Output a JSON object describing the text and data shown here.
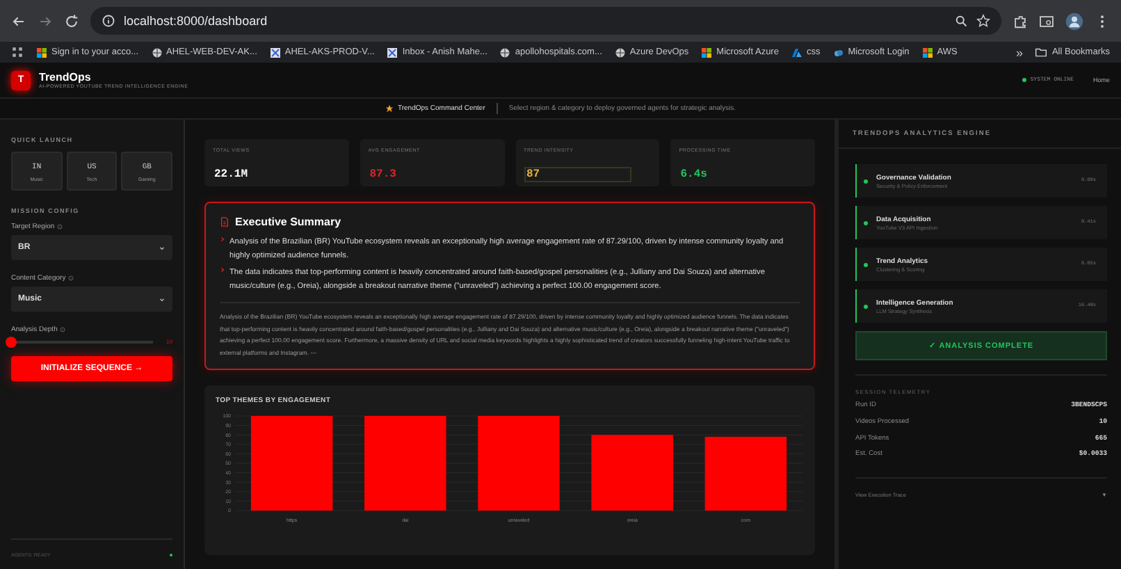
{
  "browser": {
    "url": "localhost:8000/dashboard",
    "bookmarks": [
      "Sign in to your acco...",
      "AHEL-WEB-DEV-AK...",
      "AHEL-AKS-PROD-V...",
      "Inbox - Anish Mahe...",
      "apollohospitals.com...",
      "Azure DevOps",
      "Microsoft Azure",
      "css",
      "Microsoft Login",
      "AWS"
    ],
    "more": "»",
    "all_bookmarks": "All Bookmarks"
  },
  "header": {
    "logo": "T",
    "title": "TrendOps",
    "subtitle": "AI-POWERED YOUTUBE TREND INTELLIGENCE ENGINE",
    "status": "SYSTEM ONLINE",
    "online": true,
    "nav": "Home"
  },
  "command_bar": {
    "title": "TrendOps Command Center",
    "hint": "Select region & category to deploy governed agents for strategic analysis."
  },
  "sidebar": {
    "quick_launch_title": "QUICK LAUNCH",
    "quick_launch": [
      {
        "code": "IN",
        "label": "Music"
      },
      {
        "code": "US",
        "label": "Tech"
      },
      {
        "code": "GB",
        "label": "Gaming"
      }
    ],
    "mission_title": "MISSION CONFIG",
    "fields": [
      {
        "kind": "select",
        "label": "Target Region",
        "value": "BR"
      },
      {
        "kind": "select",
        "label": "Content Category",
        "value": "Music"
      },
      {
        "kind": "slider",
        "label": "Analysis Depth",
        "level": 0,
        "reading": "10"
      }
    ],
    "button": "INITIALIZE SEQUENCE",
    "button_icon": "→",
    "footer": "AGENTS: READY"
  },
  "stats": [
    {
      "label": "TOTAL VIEWS",
      "value": "22.1M",
      "color": "#ffffff",
      "highlighted": false
    },
    {
      "label": "AVG ENGAGEMENT",
      "value": "87.3",
      "color": "#e02424",
      "highlighted": false
    },
    {
      "label": "TREND INTENSITY",
      "value": "87",
      "color": "#e3b341",
      "highlighted": true
    },
    {
      "label": "PROCESSING TIME",
      "value": "6.4s",
      "color": "#22c55e",
      "highlighted": false
    }
  ],
  "summary": {
    "title": "Executive Summary",
    "points": [
      "Analysis of the Brazilian (BR) YouTube ecosystem reveals an exceptionally high average engagement rate of 87.29/100, driven by intense community loyalty and highly optimized audience funnels.",
      "The data indicates that top-performing content is heavily concentrated around faith-based/gospel personalities (e.g., Julliany and Dai Souza) and alternative music/culture (e.g., Oreia), alongside a breakout narrative theme (\"unraveled\") achieving a perfect 100.00 engagement score."
    ],
    "detail": "Analysis of the Brazilian (BR) YouTube ecosystem reveals an exceptionally high average engagement rate of 87.29/100, driven by intense community loyalty and highly optimized audience funnels. The data indicates that top-performing content is heavily concentrated around faith-based/gospel personalities (e.g., Julliany and Dai Souza) and alternative music/culture (e.g., Oreia), alongside a breakout narrative theme (\"unraveled\") achieving a perfect 100.00 engagement score. Furthermore, a massive density of URL and social media keywords highlights a highly sophisticated trend of creators successfully funneling high-intent YouTube traffic to external platforms and Instagram. ---"
  },
  "chart": {
    "title": "TOP THEMES BY ENGAGEMENT",
    "chart_data": {
      "type": "bar",
      "categories": [
        "https",
        "dai",
        "unraveled",
        "oreia",
        "com"
      ],
      "series": [
        {
          "color": "#ff0000",
          "values": [
            100,
            100,
            100,
            80,
            78
          ]
        }
      ],
      "grid": true,
      "ylim": [
        0,
        100
      ],
      "yticks": [
        0,
        10,
        20,
        30,
        40,
        50,
        60,
        70,
        80,
        90,
        100
      ]
    }
  },
  "engine": {
    "title": "TRENDOPS ANALYTICS ENGINE",
    "steps": [
      {
        "name": "Governance Validation",
        "detail": "Security & Policy Enforcement",
        "time": "0.00s",
        "complete": true
      },
      {
        "name": "Data Acquisition",
        "detail": "YouTube V3 API Ingestion",
        "time": "0.41s",
        "complete": true
      },
      {
        "name": "Trend Analytics",
        "detail": "Clustering & Scoring",
        "time": "0.05s",
        "complete": true
      },
      {
        "name": "Intelligence Generation",
        "detail": "LLM Strategy Synthesis",
        "time": "16.48s",
        "complete": true
      }
    ],
    "complete": "✓ ANALYSIS COMPLETE",
    "telemetry_title": "SESSION TELEMETRY",
    "telemetry": [
      {
        "label": "Run ID",
        "value": "3BENDSCPS"
      },
      {
        "label": "Videos Processed",
        "value": "10"
      },
      {
        "label": "API Tokens",
        "value": "665"
      },
      {
        "label": "Est. Cost",
        "value": "$0.0033"
      }
    ],
    "trace": "View Execution Trace",
    "trace_icon": "▼"
  }
}
